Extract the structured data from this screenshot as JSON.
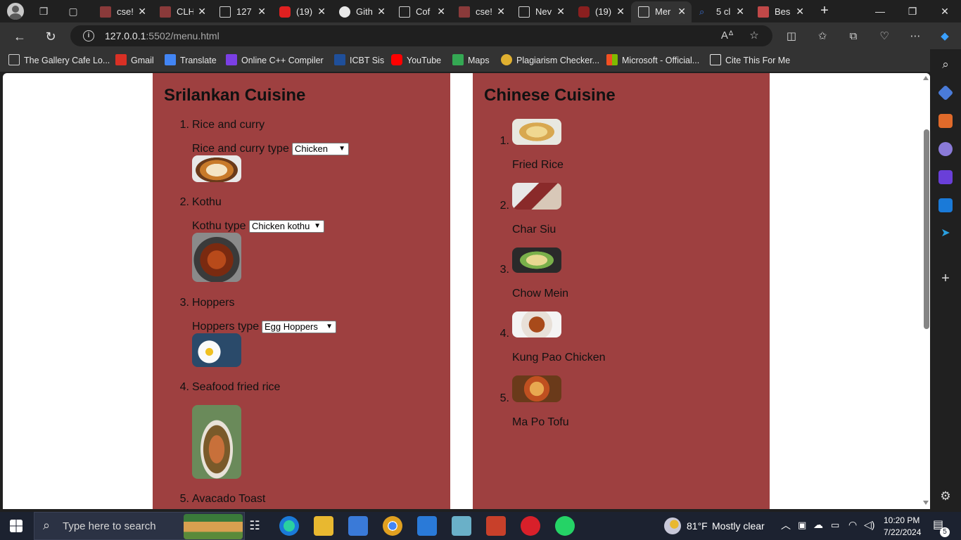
{
  "browser": {
    "tabs": [
      {
        "title": "cse!",
        "color": "#8a3a3a",
        "active": false
      },
      {
        "title": "CLH",
        "color": "#8a3a3a",
        "active": false
      },
      {
        "title": "127",
        "color": "#6b6b6b",
        "active": false
      },
      {
        "title": "(19)",
        "color": "#e02020",
        "active": false
      },
      {
        "title": "Gith",
        "color": "#e8e8e8",
        "active": false
      },
      {
        "title": "Cof",
        "color": "#6b6b6b",
        "active": false
      },
      {
        "title": "cse!",
        "color": "#8a3a3a",
        "active": false
      },
      {
        "title": "Nev",
        "color": "#6b6b6b",
        "active": false
      },
      {
        "title": "(19)",
        "color": "#8a1f1f",
        "active": false
      },
      {
        "title": "Mer",
        "color": "#d8d8d8",
        "active": true
      },
      {
        "title": "5 cl",
        "color": "#3b6fd4",
        "active": false
      },
      {
        "title": "Bes",
        "color": "#c04848",
        "active": false
      }
    ],
    "url_host": "127.0.0.1",
    "url_path": ":5502/menu.html",
    "favorites": [
      {
        "label": "The Gallery Cafe Lo...",
        "color": "#cfcfcf"
      },
      {
        "label": "Gmail",
        "color": "#d93025"
      },
      {
        "label": "Translate",
        "color": "#4285f4"
      },
      {
        "label": "Online C++ Compiler",
        "color": "#7b3fe4"
      },
      {
        "label": "ICBT Sis",
        "color": "#1f4f9a"
      },
      {
        "label": "YouTube",
        "color": "#ff0000"
      },
      {
        "label": "Maps",
        "color": "#34a853"
      },
      {
        "label": "Plagiarism Checker...",
        "color": "#e0b030"
      },
      {
        "label": "Microsoft - Official...",
        "color": "#f25022"
      },
      {
        "label": "Cite This For Me",
        "color": "#e8e8e8"
      }
    ]
  },
  "page": {
    "srilankan": {
      "heading": "Srilankan Cuisine",
      "items": [
        {
          "num": "1.",
          "name": "Rice and curry",
          "type_label": "Rice and curry type",
          "selected": "Chicken"
        },
        {
          "num": "2.",
          "name": "Kothu",
          "type_label": "Kothu type",
          "selected": "Chicken kothu"
        },
        {
          "num": "3.",
          "name": "Hoppers",
          "type_label": "Hoppers type",
          "selected": "Egg Hoppers"
        },
        {
          "num": "4.",
          "name": "Seafood fried rice"
        },
        {
          "num": "5.",
          "name": "Avacado Toast"
        }
      ]
    },
    "chinese": {
      "heading": "Chinese Cuisine",
      "items": [
        {
          "num": "1.",
          "name": "Fried Rice"
        },
        {
          "num": "2.",
          "name": "Char Siu"
        },
        {
          "num": "3.",
          "name": "Chow Mein"
        },
        {
          "num": "4.",
          "name": "Kung Pao Chicken"
        },
        {
          "num": "5.",
          "name": "Ma Po Tofu"
        }
      ]
    }
  },
  "taskbar": {
    "search_placeholder": "Type here to search",
    "weather_temp": "81°F",
    "weather_desc": "Mostly clear",
    "time": "10:20 PM",
    "date": "7/22/2024",
    "notification_count": "5"
  }
}
